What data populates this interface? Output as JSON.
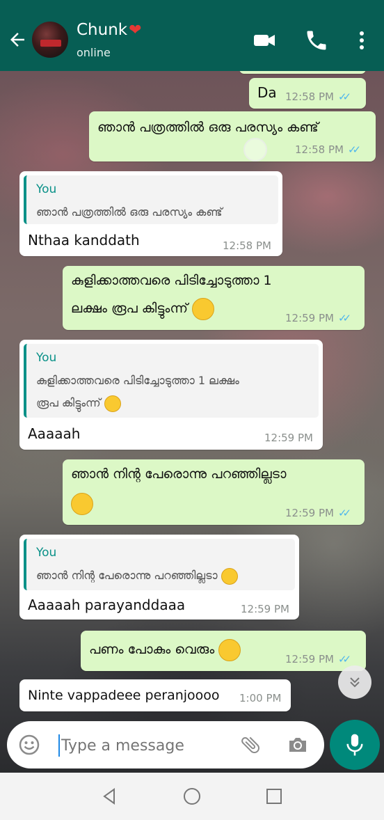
{
  "header": {
    "contact_name": "Chunk",
    "contact_status": "online",
    "heart": "❤",
    "icons": [
      "back-arrow-icon",
      "video-call-icon",
      "voice-call-icon",
      "more-vert-icon"
    ]
  },
  "messages": [
    {
      "type": "out",
      "text": "Da",
      "time": "12:58 PM"
    },
    {
      "type": "out",
      "text": "ഞാൻ പത്രത്തിൽ ഒരു പരസ്യം കണ്ട്",
      "time": "12:58 PM"
    },
    {
      "type": "in",
      "quote_author": "You",
      "quote_text": "ഞാൻ പത്രത്തിൽ ഒരു പരസ്യം കണ്ട്",
      "text": "Nthaa kanddath",
      "time": "12:58 PM"
    },
    {
      "type": "out",
      "text_line1": "കുളിക്കാത്തവരെ പിടിച്ചോടുത്താ 1",
      "text_line2": "ലക്ഷം രൂപ കിട്ടുംന്ന്",
      "time": "12:59 PM"
    },
    {
      "type": "in",
      "quote_author": "You",
      "quote_line1": "കുളിക്കാത്തവരെ പിടിച്ചോടുത്താ 1 ലക്ഷം",
      "quote_line2": "രൂപ കിട്ടുംന്ന്",
      "text": "Aaaaah",
      "time": "12:59 PM"
    },
    {
      "type": "out",
      "text": "ഞാൻ നിന്റ പേരൊന്നു പറഞ്ഞില്ലടാ",
      "time": "12:59 PM"
    },
    {
      "type": "in",
      "quote_author": "You",
      "quote_text": "ഞാൻ നിന്റ പേരൊന്നു പറഞ്ഞില്ലടാ",
      "text": "Aaaaah parayanddaaa",
      "time": "12:59 PM"
    },
    {
      "type": "out",
      "text": "പണം പോകും വെരും",
      "time": "12:59 PM"
    },
    {
      "type": "in",
      "text": "Ninte vappadeee peranjoooo",
      "time": "1:00 PM"
    }
  ],
  "ticks": "✓✓",
  "input": {
    "placeholder": "Type a message"
  },
  "colors": {
    "header": "#075e54",
    "outgoing": "#dcf8c6",
    "incoming": "#ffffff",
    "accent": "#00897b",
    "tick_read": "#4fb6ec",
    "quote_bar": "#0a9188"
  }
}
